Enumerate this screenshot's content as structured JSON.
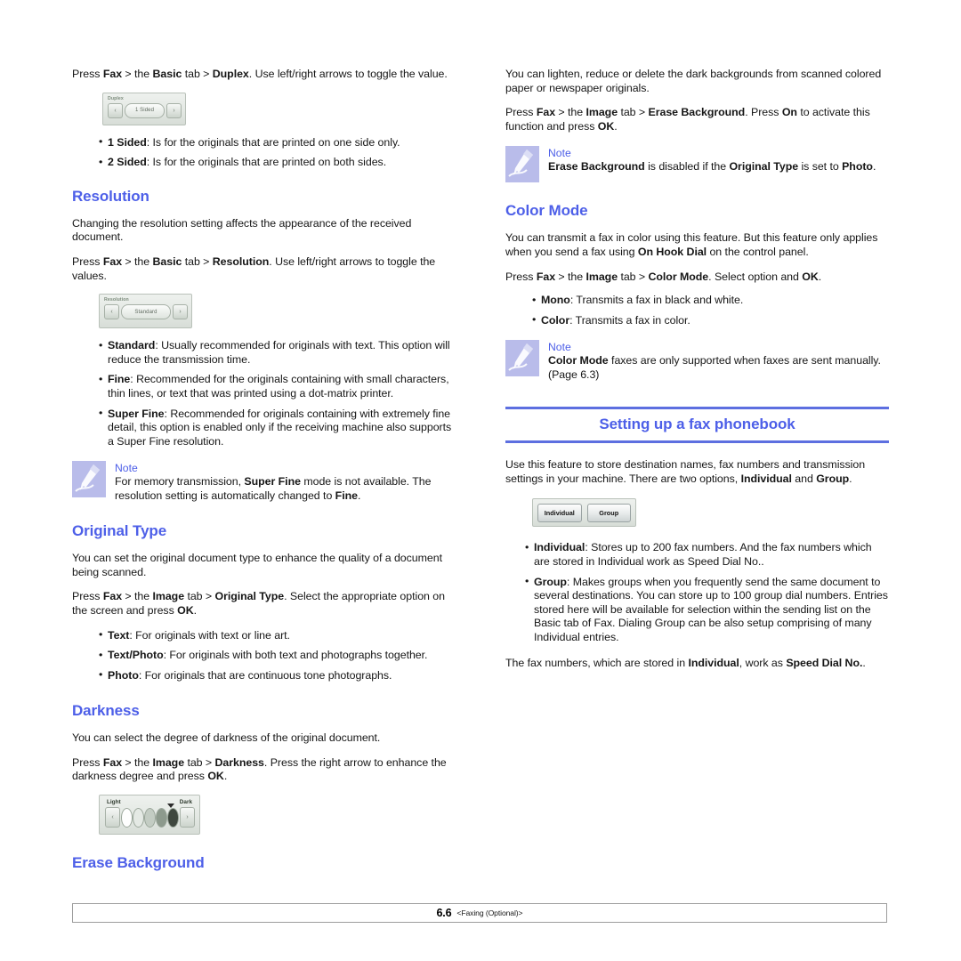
{
  "page": {
    "footer_page_number": "6.6",
    "footer_title": "<Faxing (Optional)>",
    "accent_color": "#4d5fe8",
    "rule_color": "#5d6fe0"
  },
  "left_column": {
    "duplex": {
      "intro_parts": [
        "Press ",
        "Fax",
        " > the ",
        "Basic",
        " tab > ",
        "Duplex",
        ". Use left/right arrows to toggle the value."
      ],
      "widget": {
        "name": "duplex-spinner",
        "label": "Duplex",
        "value": "1 Sided",
        "left_arrow": "‹",
        "right_arrow": "›"
      },
      "bullets": [
        {
          "term": "1 Sided",
          "text": ": Is for the originals that are printed on one side only."
        },
        {
          "term": "2 Sided",
          "text": ": Is for the originals that are printed on both sides."
        }
      ]
    },
    "resolution": {
      "heading": "Resolution",
      "paragraph1": "Changing the resolution setting affects the appearance of the received document.",
      "paragraph2_parts": [
        "Press ",
        "Fax",
        " > the ",
        "Basic",
        " tab > ",
        "Resolution",
        ". Use left/right arrows to toggle the values."
      ],
      "widget": {
        "name": "resolution-spinner",
        "label": "Resolution",
        "value": "Standard",
        "left_arrow": "‹",
        "right_arrow": "›"
      },
      "bullets": [
        {
          "term": "Standard",
          "text": ": Usually recommended for originals with text. This option will reduce the transmission time."
        },
        {
          "term": "Fine",
          "text": ": Recommended for the originals containing with small characters, thin lines, or text that was printed using a dot-matrix printer."
        },
        {
          "term": "Super Fine",
          "text": ": Recommended for originals containing with extremely fine detail, this option is enabled only if the receiving machine also supports a Super Fine resolution."
        }
      ],
      "note": {
        "title": "Note",
        "text_parts": [
          "For memory transmission, ",
          "Super Fine",
          " mode is not available. The resolution setting is automatically changed to ",
          "Fine",
          "."
        ]
      }
    },
    "original_type": {
      "heading": "Original Type",
      "paragraph1": "You can set the original document type to enhance the quality of a document being scanned.",
      "paragraph2_parts": [
        "Press ",
        "Fax",
        " > the ",
        "Image",
        " tab > ",
        "Original Type",
        ". Select the appropriate option on the screen and press ",
        "OK",
        "."
      ],
      "bullets": [
        {
          "term": "Text",
          "text": ": For originals with text or line art."
        },
        {
          "term": "Text/Photo",
          "text": ": For originals with both text and photographs together."
        },
        {
          "term": "Photo",
          "text": ": For originals that are continuous tone photographs."
        }
      ]
    },
    "darkness": {
      "heading": "Darkness",
      "paragraph1": "You can select the degree of darkness of the original document.",
      "paragraph2_parts": [
        "Press ",
        "Fax",
        " > the ",
        "Image",
        " tab > ",
        "Darkness",
        ". Press the right arrow to enhance the darkness degree and press ",
        "OK",
        "."
      ],
      "widget": {
        "name": "darkness-slider",
        "label_light": "Light",
        "label_dark": "Dark",
        "left_arrow": "‹",
        "right_arrow": "›"
      }
    },
    "erase_background_heading": "Erase Background"
  },
  "right_column": {
    "erase_background": {
      "paragraph1": "You can lighten, reduce or delete the dark backgrounds from scanned colored paper or newspaper originals.",
      "paragraph2_parts": [
        "Press ",
        "Fax",
        " > the ",
        "Image",
        " tab > ",
        "Erase Background",
        ". Press ",
        "On",
        " to activate this function and press ",
        "OK",
        "."
      ],
      "note": {
        "title": "Note",
        "text_parts": [
          "Erase Background",
          " is disabled if the ",
          "Original Type",
          " is set to ",
          "Photo",
          "."
        ]
      }
    },
    "color_mode": {
      "heading": "Color Mode",
      "paragraph1_parts": [
        "You can transmit a fax in color using this feature. But this feature only applies when you send a fax using ",
        "On Hook Dial",
        " on the control panel."
      ],
      "paragraph2_parts": [
        "Press ",
        "Fax",
        " > the ",
        "Image",
        " tab > ",
        "Color Mode",
        ". Select option and ",
        "OK",
        "."
      ],
      "bullets": [
        {
          "term": "Mono",
          "text": ": Transmits a fax in black and white."
        },
        {
          "term": "Color",
          "text": ": Transmits a fax in color."
        }
      ],
      "note": {
        "title": "Note",
        "text_parts": [
          "Color Mode",
          " faxes are only supported when faxes are sent manually. (Page 6.3)"
        ]
      }
    },
    "phonebook": {
      "banner_heading": "Setting up a fax phonebook",
      "paragraph1_parts": [
        "Use this feature to store destination names, fax numbers and transmission settings in your machine. There are two options, ",
        "Individual",
        " and ",
        "Group",
        "."
      ],
      "widget": {
        "name": "phonebook-buttons",
        "button_individual": "Individual",
        "button_group": "Group"
      },
      "bullets": [
        {
          "term": "Individual",
          "text": ": Stores up to 200 fax numbers. And the fax numbers which are stored in Individual work as Speed Dial No.."
        },
        {
          "term": "Group",
          "text": ": Makes groups when you frequently send the same document to several destinations. You can store up to 100 group dial numbers. Entries stored here will be available for selection within the sending list on the Basic tab of Fax. Dialing Group can be also setup comprising of many Individual entries."
        }
      ],
      "closing_paragraph_parts": [
        "The fax numbers, which are stored in ",
        "Individual",
        ", work as ",
        "Speed Dial No.",
        "."
      ]
    }
  }
}
